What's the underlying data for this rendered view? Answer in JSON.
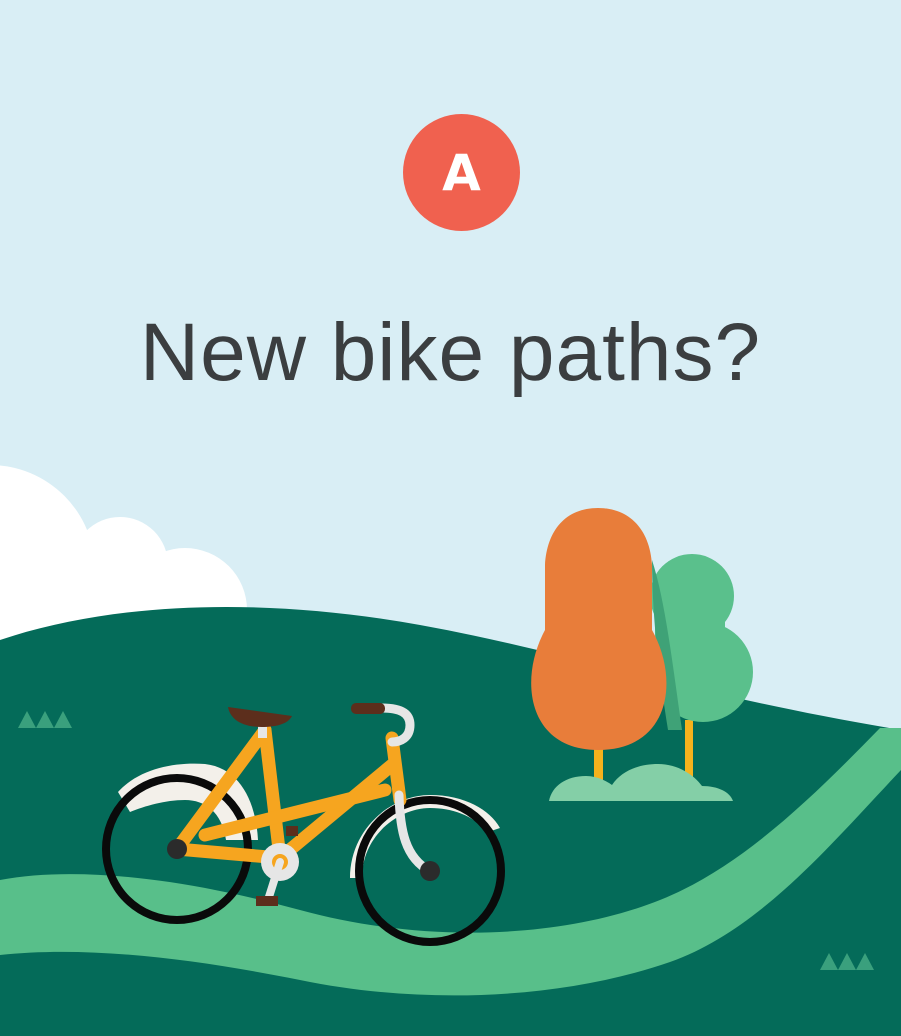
{
  "badge": {
    "letter": "A"
  },
  "question": {
    "text": "New bike paths?"
  },
  "colors": {
    "sky": "#d9eef5",
    "badge": "#f0614f",
    "question_text": "#3b3e40",
    "hill": "#046b59",
    "path": "#58bf8a",
    "cloud": "#ffffff",
    "tree_orange": "#e87d3a",
    "tree_green": "#5ac08c",
    "tree_green_dark": "#3fa277",
    "tree_trunk": "#f6b21c",
    "bush": "#84cfa7",
    "bike_frame": "#f6a51f",
    "bike_seat": "#5c2e1c",
    "fender": "#f3f0ea",
    "tire": "#0a0a0a"
  },
  "icons": [
    "cloud-illustration",
    "hill-illustration",
    "bike-path-illustration",
    "orange-tree-illustration",
    "green-tree-illustration",
    "bush-illustration",
    "bicycle-illustration",
    "grass-tuft-icon"
  ]
}
